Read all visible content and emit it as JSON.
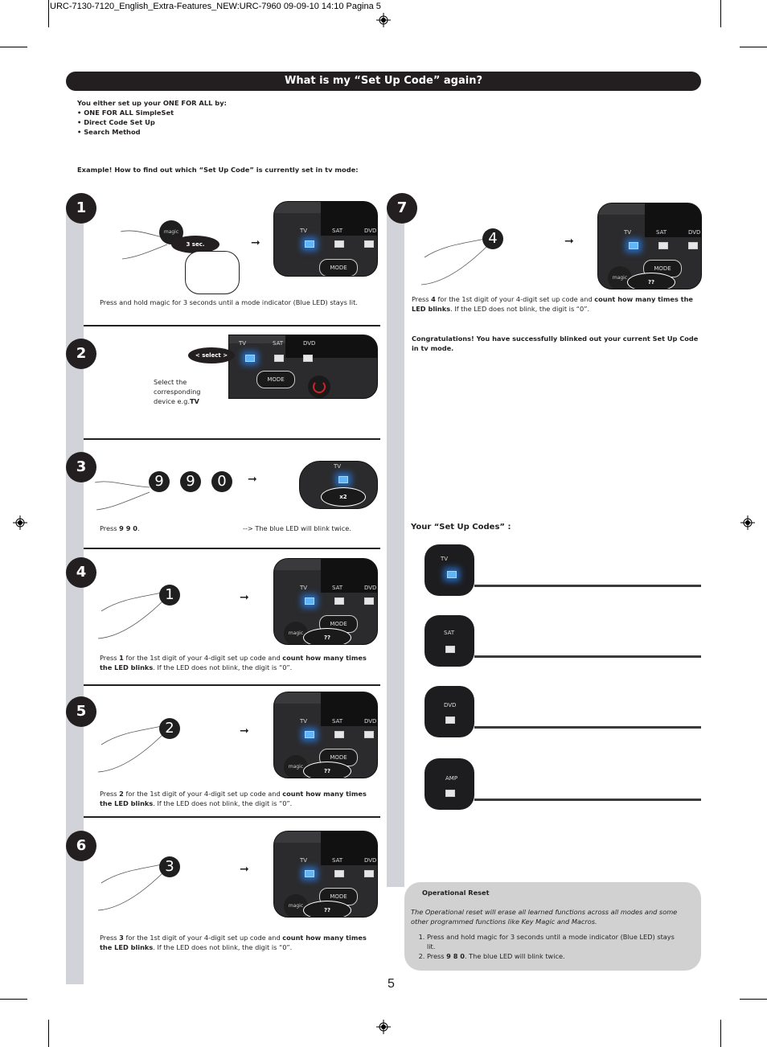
{
  "slug": "URC-7130-7120_English_Extra-Features_NEW:URC-7960  09-09-10  14:10  Pagina 5",
  "title": "What is my “Set Up Code” again?",
  "intro": {
    "lead": "You either set up your ONE FOR ALL by:",
    "methods": [
      "• ONE FOR ALL SimpleSet",
      "• Direct Code Set Up",
      "• Search Method"
    ]
  },
  "example": "Example! How to find out which “Set Up Code” is currently set in tv mode:",
  "remote_labels": {
    "tv": "TV",
    "sat": "SAT",
    "dvd": "DVD",
    "amp": "AMP",
    "mode": "MODE",
    "magic": "magic",
    "blinks": "??"
  },
  "steps": [
    {
      "num": "1",
      "badge": "3 sec.",
      "caption": "Press and hold magic for 3 seconds until a mode indicator (Blue LED) stays lit."
    },
    {
      "num": "2",
      "badge": "< select >",
      "caption_pre": "Select the corresponding device e.g.",
      "caption_bold": "TV"
    },
    {
      "num": "3",
      "keys": [
        "9",
        "9",
        "0"
      ],
      "badge": "x2",
      "caption_pre": "Press ",
      "caption_bold": "9 9 0",
      "caption_post": ".",
      "result": "--> The blue LED will blink twice."
    },
    {
      "num": "4",
      "key": "1",
      "caption_pre": "Press ",
      "caption_bold": "1",
      "caption_mid": " for the 1st digit of your 4-digit set up code and ",
      "caption_bold2": "count how many times the LED blinks",
      "caption_post": ". If the LED does not blink, the digit is “0”."
    },
    {
      "num": "5",
      "key": "2",
      "caption_pre": "Press ",
      "caption_bold": "2",
      "caption_mid": " for the 1st digit of your 4-digit set up code and ",
      "caption_bold2": "count how many times the LED blinks",
      "caption_post": ". If the LED does not blink, the digit is “0”."
    },
    {
      "num": "6",
      "key": "3",
      "caption_pre": "Press ",
      "caption_bold": "3",
      "caption_mid": " for the 1st digit of your 4-digit set up code and ",
      "caption_bold2": "count how many times the LED blinks",
      "caption_post": ". If the LED does not blink, the digit is “0”."
    },
    {
      "num": "7",
      "key": "4",
      "caption_pre": "Press ",
      "caption_bold": "4",
      "caption_mid": " for the 1st digit of your 4-digit set up code and ",
      "caption_bold2": "count how many times the LED blinks",
      "caption_post": ". If the LED does not blink, the digit is “0”."
    }
  ],
  "congrats": "Congratulations! You have successfully blinked out your current Set Up Code in tv mode.",
  "set_up_codes": {
    "heading": "Your “Set Up Codes” :",
    "devices": [
      "TV",
      "SAT",
      "DVD",
      "AMP"
    ]
  },
  "reset": {
    "heading": "Operational Reset",
    "description": "The Operational reset will erase all learned functions across all modes and some other programmed functions like Key Magic and Macros.",
    "step1": "Press and hold magic for 3 seconds until a mode indicator (Blue LED) stays lit.",
    "step2_pre": "Press ",
    "step2_bold": "9 8 0",
    "step2_post": ". The blue LED will blink twice."
  },
  "page_number": "5"
}
